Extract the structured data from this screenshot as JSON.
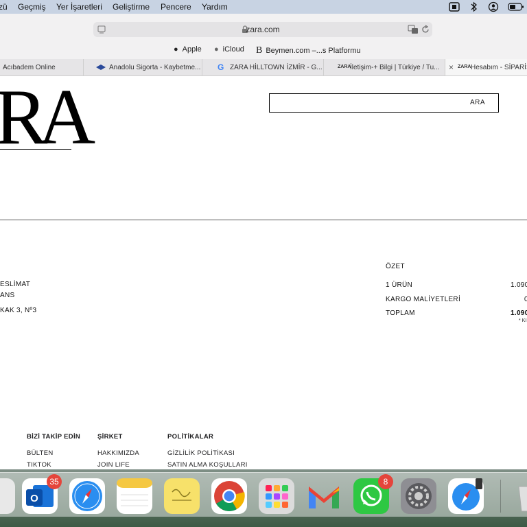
{
  "menubar": {
    "items": [
      "zü",
      "Geçmiş",
      "Yer İşaretleri",
      "Geliştirme",
      "Pencere",
      "Yardım"
    ]
  },
  "toolbar": {
    "url": "zara.com"
  },
  "favorites": [
    "Apple",
    "iCloud",
    "Beymen.com –...s Platformu"
  ],
  "tabs": [
    "Acıbadem Online",
    "Anadolu Sigorta - Kaybetme...",
    "ZARA HİLLTOWN İZMİR - G...",
    "İletişim-+ Bilgi | Türkiye / Tu...",
    "Hesabım - SİPARİŞ"
  ],
  "page": {
    "logo_text": "RA",
    "search_label": "ARA",
    "delivery": {
      "heading": "ESLİMAT",
      "line1": "ANS",
      "line2": "KAK 3, Nº3"
    },
    "summary": {
      "title": "ÖZET",
      "rows": [
        {
          "label": "1 ÜRÜN",
          "value": "1.090"
        },
        {
          "label": "KARGO MALİYETLERİ",
          "value": "0"
        },
        {
          "label": "TOPLAM",
          "value": "1.090"
        }
      ],
      "note": "* KI"
    },
    "footer": {
      "columns": [
        {
          "heading": "BİZİ TAKİP EDİN",
          "links": [
            "BÜLTEN",
            "TIKTOK"
          ]
        },
        {
          "heading": "ŞİRKET",
          "links": [
            "HAKKIMIZDA",
            "JOIN LIFE"
          ]
        },
        {
          "heading": "POLİTİKALAR",
          "links": [
            "GİZLİLİK POLİTİKASI",
            "SATIN ALMA KOŞULLARI"
          ]
        }
      ]
    }
  },
  "dock": {
    "apps": [
      {
        "icon": "settings-edge-icon"
      },
      {
        "icon": "outlook-icon",
        "badge": "35"
      },
      {
        "icon": "safari-icon"
      },
      {
        "icon": "notes-icon"
      },
      {
        "icon": "stickies-icon"
      },
      {
        "icon": "chrome-icon"
      },
      {
        "icon": "launchpad-icon"
      },
      {
        "icon": "gmail-icon"
      },
      {
        "icon": "whatsapp-icon",
        "badge": "8"
      },
      {
        "icon": "system-preferences-icon"
      },
      {
        "icon": "safari-mobile-icon"
      },
      {
        "icon": "trash-icon"
      }
    ]
  }
}
